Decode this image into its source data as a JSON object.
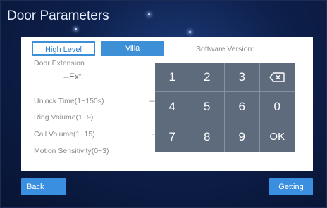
{
  "page": {
    "title": "Door Parameters"
  },
  "tabs": {
    "high_level": "High Level",
    "villa": "Villa"
  },
  "software_version_label": "Software Version:",
  "door_extension": {
    "label": "Door Extension",
    "value": "--Ext."
  },
  "params": [
    {
      "label": "Unlock Time(1~150s)",
      "value": "---s"
    },
    {
      "label": "Ring Volume(1~9)",
      "value": "-"
    },
    {
      "label": "Call Volume(1~15)",
      "value": "--"
    },
    {
      "label": "Motion Sensitivity(0~3)",
      "value": "-"
    }
  ],
  "keypad": {
    "keys": [
      "1",
      "2",
      "3",
      "",
      "4",
      "5",
      "6",
      "0",
      "7",
      "8",
      "9",
      "OK"
    ],
    "backspace_icon": "backspace-icon",
    "color": "#5e6b7d"
  },
  "buttons": {
    "back": "Back",
    "getting": "Getting"
  },
  "colors": {
    "accent": "#3d8fd6",
    "background": "#0d1f4a"
  }
}
